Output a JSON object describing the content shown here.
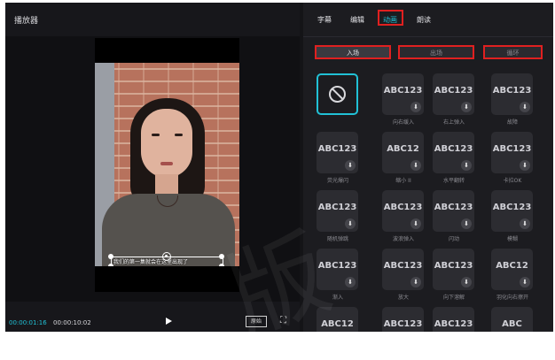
{
  "player": {
    "title": "播放器",
    "subtitle_text": "我们的第一集就会在这里出现了",
    "time_current": "00:00:01:16",
    "time_total": "00:00:10:02",
    "ratio_label": "原始",
    "icons": [
      "play-icon",
      "fullscreen-icon",
      "rotate-icon"
    ]
  },
  "panel": {
    "tabs": [
      "字幕",
      "编辑",
      "动画",
      "朗读"
    ],
    "active_tab": "动画",
    "subtabs": [
      "入场",
      "出场",
      "循环"
    ],
    "active_subtab": "入场",
    "animations": [
      {
        "label": "",
        "thumb": "none"
      },
      {
        "label": "向右缓入",
        "thumb": "ABC123"
      },
      {
        "label": "右上弹入",
        "thumb": "ABC123"
      },
      {
        "label": "故障",
        "thumb": "ABC123"
      },
      {
        "label": "荧光爆闪",
        "thumb": "ABC123"
      },
      {
        "label": "缩小 II",
        "thumb": "ABC12"
      },
      {
        "label": "水平翻转",
        "thumb": "ABC123"
      },
      {
        "label": "卡拉OK",
        "thumb": "ABC123"
      },
      {
        "label": "随机弹跳",
        "thumb": "ABC123"
      },
      {
        "label": "波浪弹入",
        "thumb": "ABC123"
      },
      {
        "label": "闪动",
        "thumb": "ABC123"
      },
      {
        "label": "模糊",
        "thumb": "ABC123"
      },
      {
        "label": "渐入",
        "thumb": "ABC123"
      },
      {
        "label": "放大",
        "thumb": "ABC123"
      },
      {
        "label": "向下溶解",
        "thumb": "ABC123"
      },
      {
        "label": "羽化向右擦开",
        "thumb": "ABC12"
      },
      {
        "label": "",
        "thumb": "ABC12"
      },
      {
        "label": "",
        "thumb": "ABC123"
      },
      {
        "label": "",
        "thumb": "ABC123"
      },
      {
        "label": "",
        "thumb": "ABC"
      }
    ]
  },
  "colors": {
    "accent": "#21c1d6",
    "highlight": "#e02020",
    "panel_bg": "#1c1c20"
  }
}
